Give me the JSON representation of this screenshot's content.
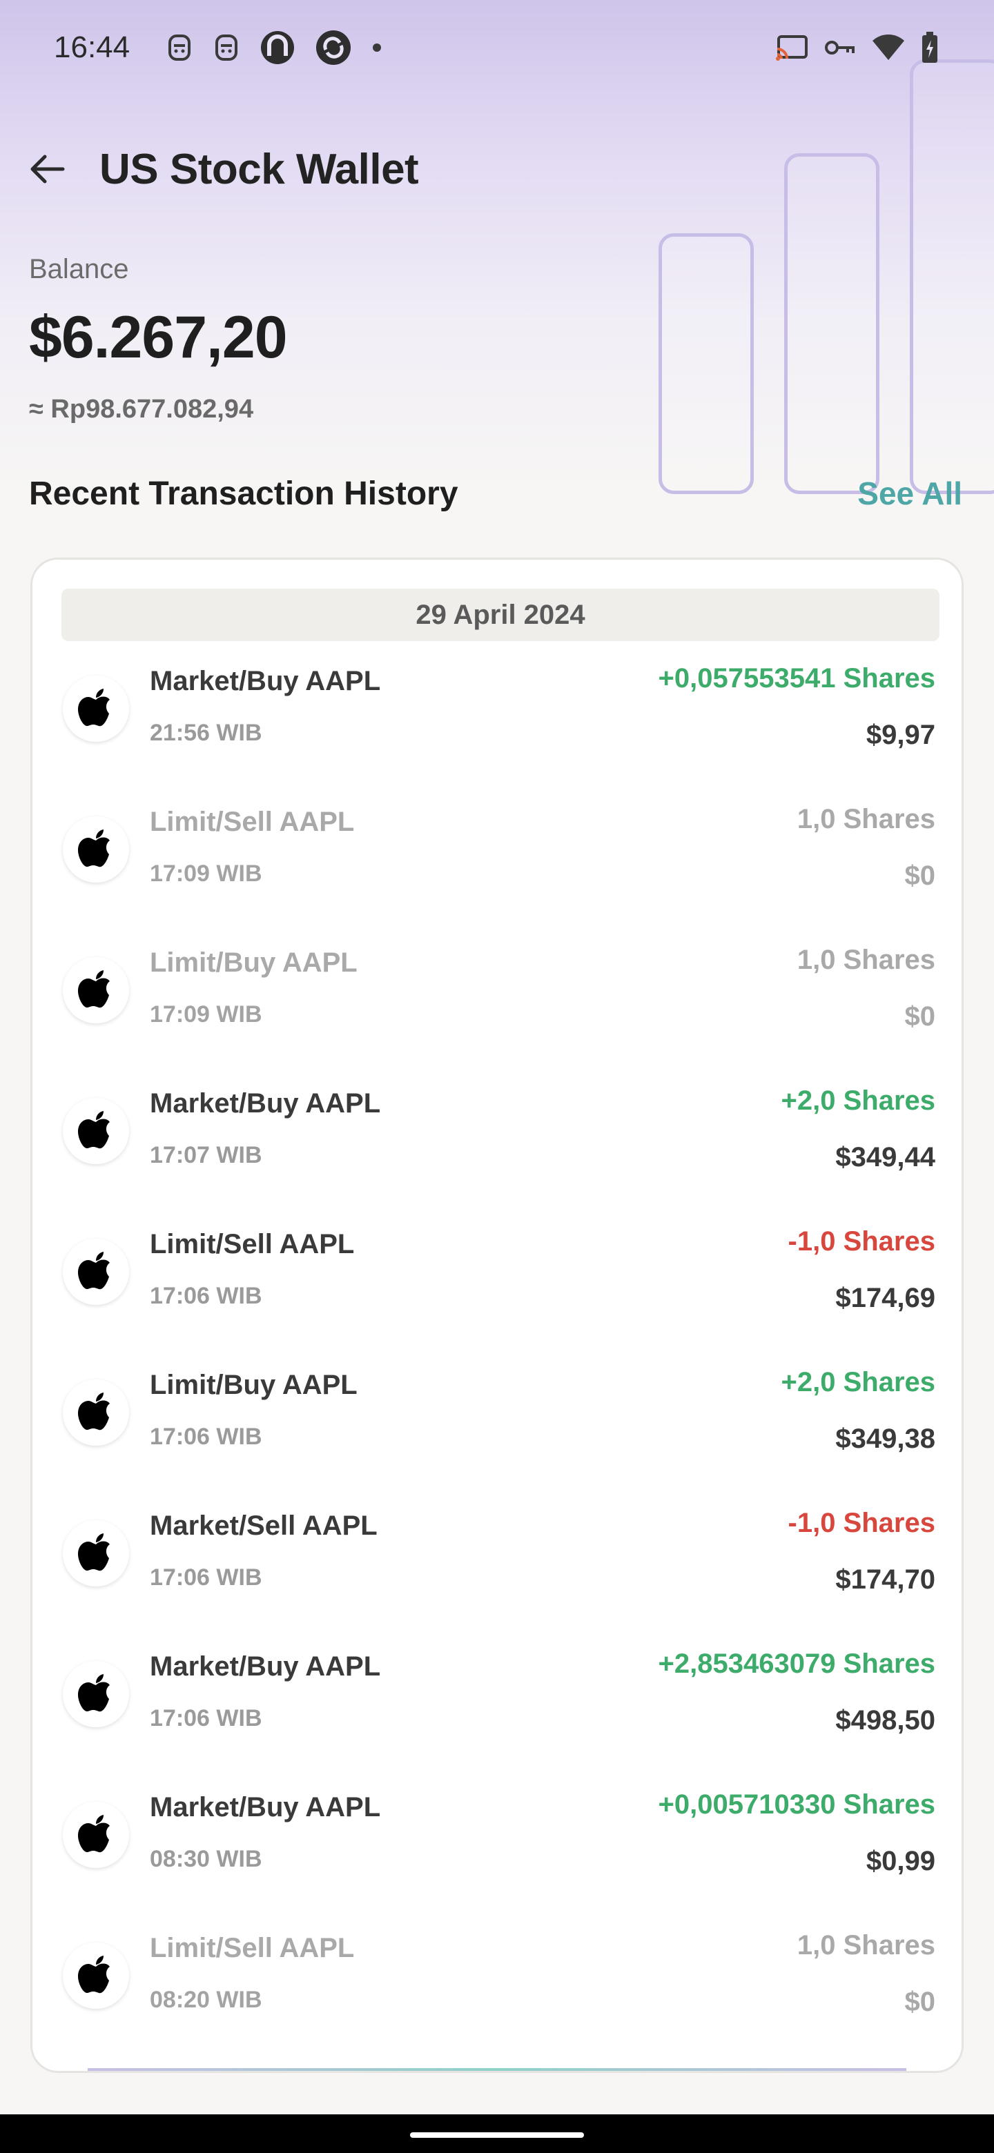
{
  "status_bar": {
    "time": "16:44",
    "left_icons": [
      "notification-icon",
      "notification-icon",
      "app-icon",
      "app-icon",
      "dot-icon"
    ],
    "right_icons": [
      "cast-icon",
      "vpn-key-icon",
      "wifi-icon",
      "battery-charging-icon"
    ]
  },
  "header": {
    "title": "US Stock Wallet",
    "back_icon": "arrow-left-icon"
  },
  "balance": {
    "label": "Balance",
    "value": "$6.267,20",
    "converted": "≈ Rp98.677.082,94"
  },
  "history": {
    "title": "Recent Transaction History",
    "see_all": "See All",
    "date": "29 April 2024",
    "transactions": [
      {
        "title": "Market/Buy AAPL",
        "time": "21:56 WIB",
        "shares": "+0,057553541 Shares",
        "amount": "$9,97",
        "status": "positive"
      },
      {
        "title": "Limit/Sell AAPL",
        "time": "17:09 WIB",
        "shares": "1,0 Shares",
        "amount": "$0",
        "status": "muted"
      },
      {
        "title": "Limit/Buy AAPL",
        "time": "17:09 WIB",
        "shares": "1,0 Shares",
        "amount": "$0",
        "status": "muted"
      },
      {
        "title": "Market/Buy AAPL",
        "time": "17:07 WIB",
        "shares": "+2,0 Shares",
        "amount": "$349,44",
        "status": "positive"
      },
      {
        "title": "Limit/Sell AAPL",
        "time": "17:06 WIB",
        "shares": "-1,0 Shares",
        "amount": "$174,69",
        "status": "negative"
      },
      {
        "title": "Limit/Buy AAPL",
        "time": "17:06 WIB",
        "shares": "+2,0 Shares",
        "amount": "$349,38",
        "status": "positive"
      },
      {
        "title": "Market/Sell AAPL",
        "time": "17:06 WIB",
        "shares": "-1,0 Shares",
        "amount": "$174,70",
        "status": "negative"
      },
      {
        "title": "Market/Buy AAPL",
        "time": "17:06 WIB",
        "shares": "+2,853463079 Shares",
        "amount": "$498,50",
        "status": "positive"
      },
      {
        "title": "Market/Buy AAPL",
        "time": "08:30 WIB",
        "shares": "+0,005710330 Shares",
        "amount": "$0,99",
        "status": "positive"
      },
      {
        "title": "Limit/Sell AAPL",
        "time": "08:20 WIB",
        "shares": "1,0 Shares",
        "amount": "$0",
        "status": "muted"
      }
    ]
  },
  "colors": {
    "positive": "#3dab6a",
    "negative": "#d8473d",
    "accent": "#4ea6a6",
    "muted": "#a9a9a9"
  }
}
